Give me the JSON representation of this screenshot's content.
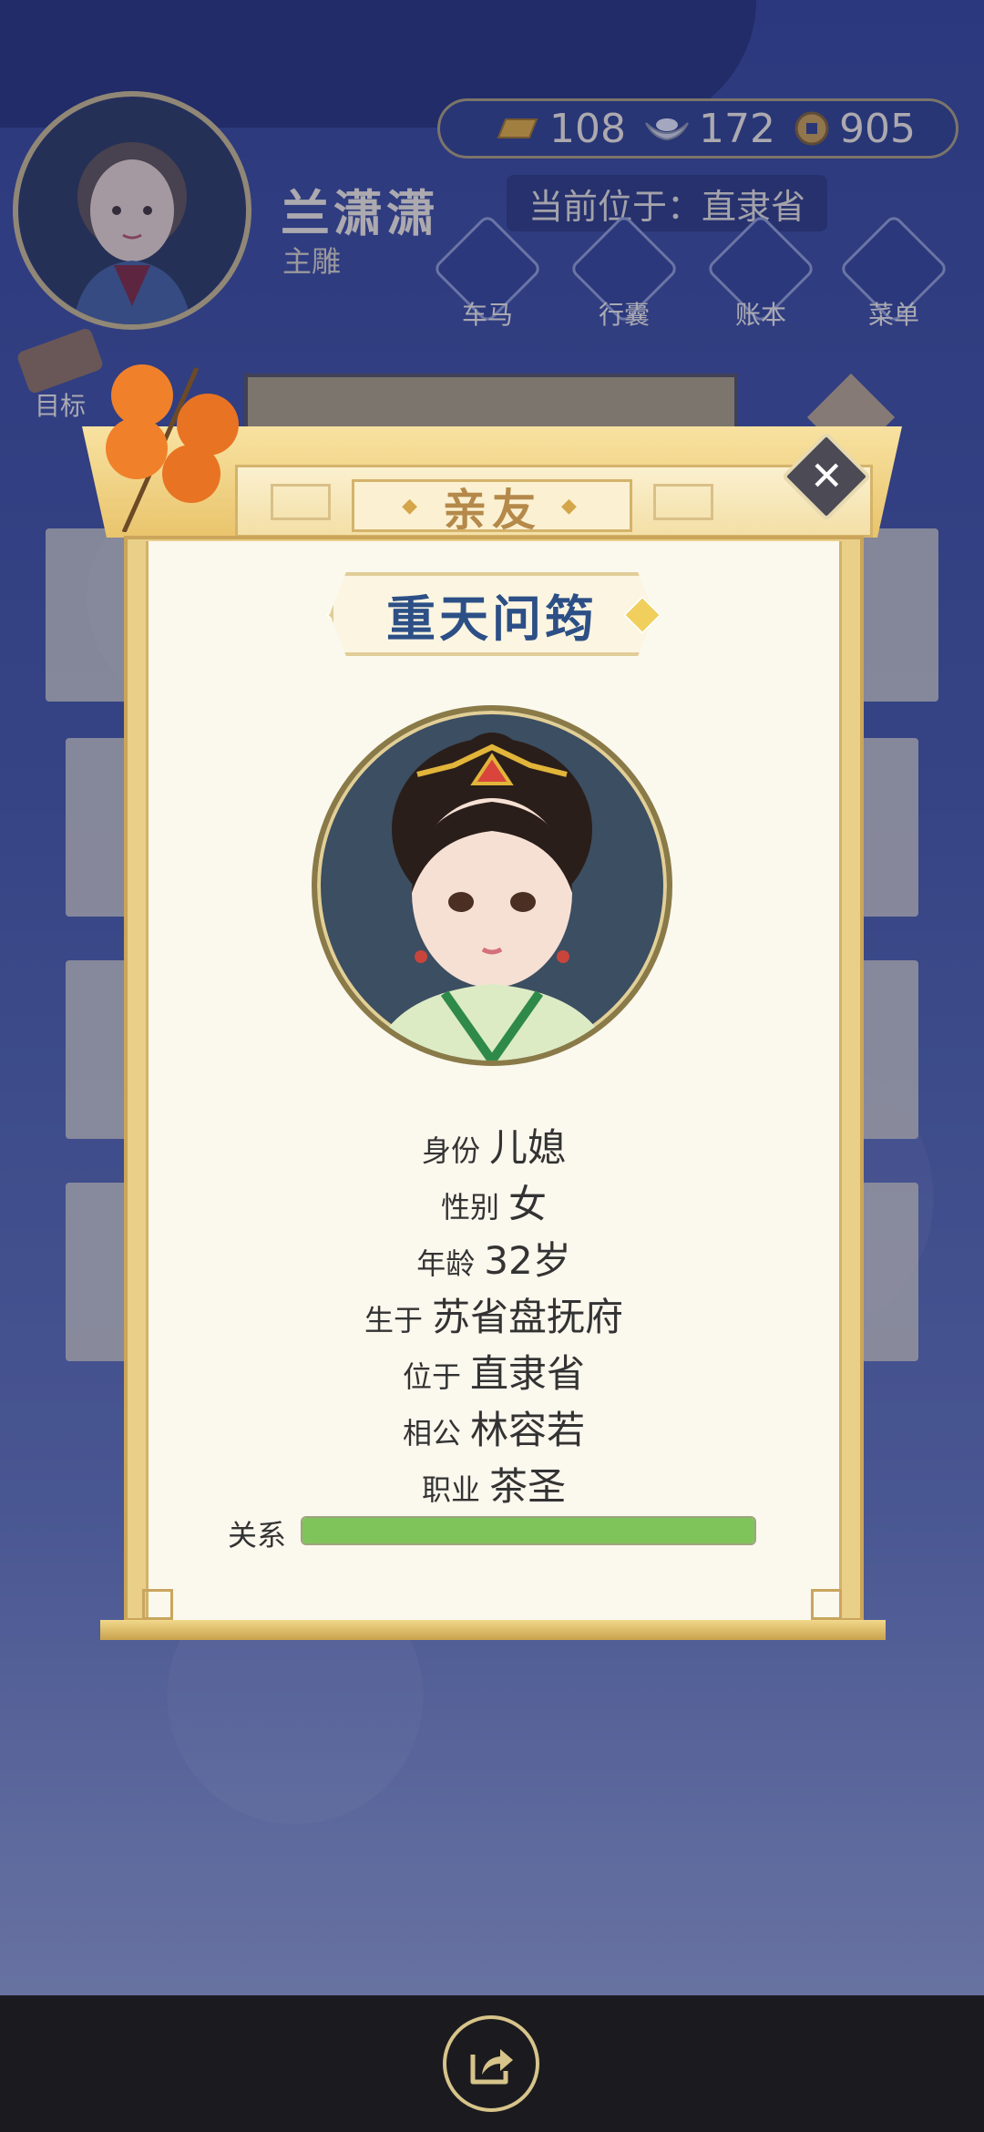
{
  "header": {
    "player_name": "兰潇潇",
    "player_role": "主雕",
    "currencies": [
      {
        "icon": "gold-ingot-icon",
        "value": "108"
      },
      {
        "icon": "silver-ingot-icon",
        "value": "172"
      },
      {
        "icon": "copper-coin-icon",
        "value": "905"
      }
    ],
    "location": "当前位于：直隶省",
    "nav": [
      {
        "label": "车马",
        "icon": "carriage-icon"
      },
      {
        "label": "行囊",
        "icon": "bag-icon"
      },
      {
        "label": "账本",
        "icon": "ledger-icon"
      },
      {
        "label": "菜单",
        "icon": "menu-dots-icon"
      }
    ],
    "goal_label": "目标"
  },
  "background_title": "亲友",
  "modal": {
    "title": "亲友",
    "name": "重天问筠",
    "fields": [
      {
        "key": "身份",
        "value": "儿媳"
      },
      {
        "key": "性别",
        "value": "女"
      },
      {
        "key": "年龄",
        "value": "32岁"
      },
      {
        "key": "生于",
        "value": "苏省盘抚府"
      },
      {
        "key": "位于",
        "value": "直隶省"
      },
      {
        "key": "相公",
        "value": "林容若"
      },
      {
        "key": "职业",
        "value": "茶圣"
      }
    ],
    "relation_label": "关系",
    "relation_level": 1.0,
    "relation_color": "#7fc45a"
  },
  "footer": {
    "share_icon": "share-icon"
  }
}
